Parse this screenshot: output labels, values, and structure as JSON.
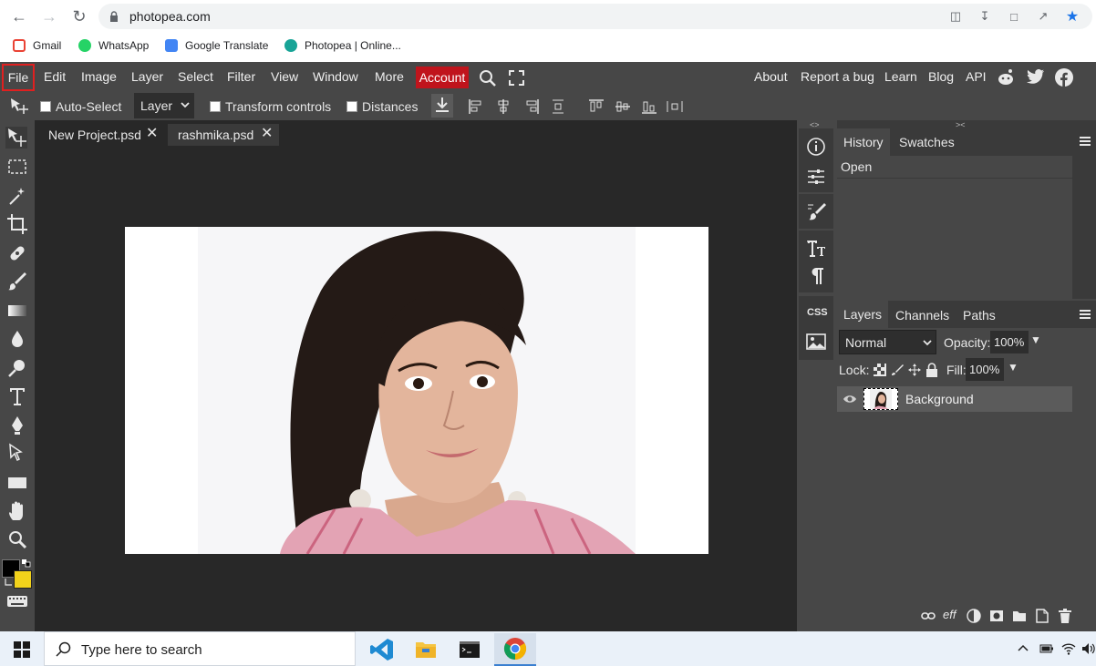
{
  "browser": {
    "url": "photopea.com",
    "bookmarks": [
      {
        "label": "Gmail",
        "icon": "gmail-icon",
        "color": "#ea4335"
      },
      {
        "label": "WhatsApp",
        "icon": "whatsapp-icon",
        "color": "#25d366"
      },
      {
        "label": "Google Translate",
        "icon": "google-translate-icon",
        "color": "#4285f4"
      },
      {
        "label": "Photopea | Online...",
        "icon": "photopea-icon",
        "color": "#18a497"
      }
    ]
  },
  "menu": {
    "file": "File",
    "items": [
      "Edit",
      "Image",
      "Layer",
      "Select",
      "Filter",
      "View",
      "Window",
      "More"
    ],
    "account": "Account",
    "right_items": [
      "About",
      "Report a bug",
      "Learn",
      "Blog",
      "API"
    ]
  },
  "options": {
    "auto_select": "Auto-Select",
    "layer_select": "Layer",
    "transform_controls": "Transform controls",
    "distances": "Distances"
  },
  "documents": {
    "tabs": [
      {
        "label": "New Project.psd",
        "active": true
      },
      {
        "label": "rashmika.psd",
        "active": false
      }
    ]
  },
  "history_panel": {
    "tabs": [
      "History",
      "Swatches"
    ],
    "items": [
      "Open"
    ]
  },
  "layers_panel": {
    "tabs": [
      "Layers",
      "Channels",
      "Paths"
    ],
    "blend_mode": "Normal",
    "opacity_label": "Opacity:",
    "opacity": "100%",
    "lock_label": "Lock:",
    "fill_label": "Fill:",
    "fill": "100%",
    "layers": [
      {
        "name": "Background",
        "visible": true
      }
    ]
  },
  "taskbar": {
    "search_placeholder": "Type here to search"
  },
  "colors": {
    "foreground": "#000000",
    "background": "#f2d21b",
    "accent_red": "#c0141c"
  }
}
